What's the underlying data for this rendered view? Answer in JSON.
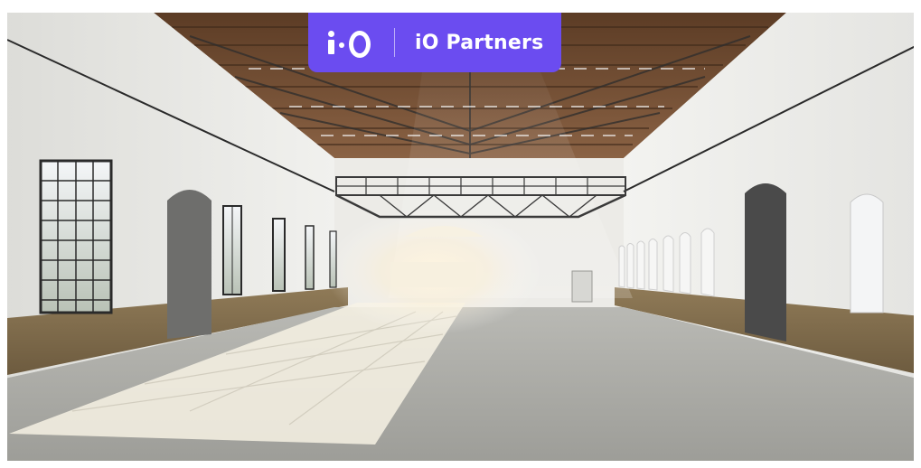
{
  "brand": {
    "name": "iO Partners",
    "logo_mark": "i·O",
    "badge_color": "#6b4cf0"
  },
  "scene": {
    "wall_color": "#e9e9e6",
    "floor_color": "#a9a9a4",
    "stone_color": "#8a7452",
    "ceiling_wood_color": "#6e4a2e"
  }
}
